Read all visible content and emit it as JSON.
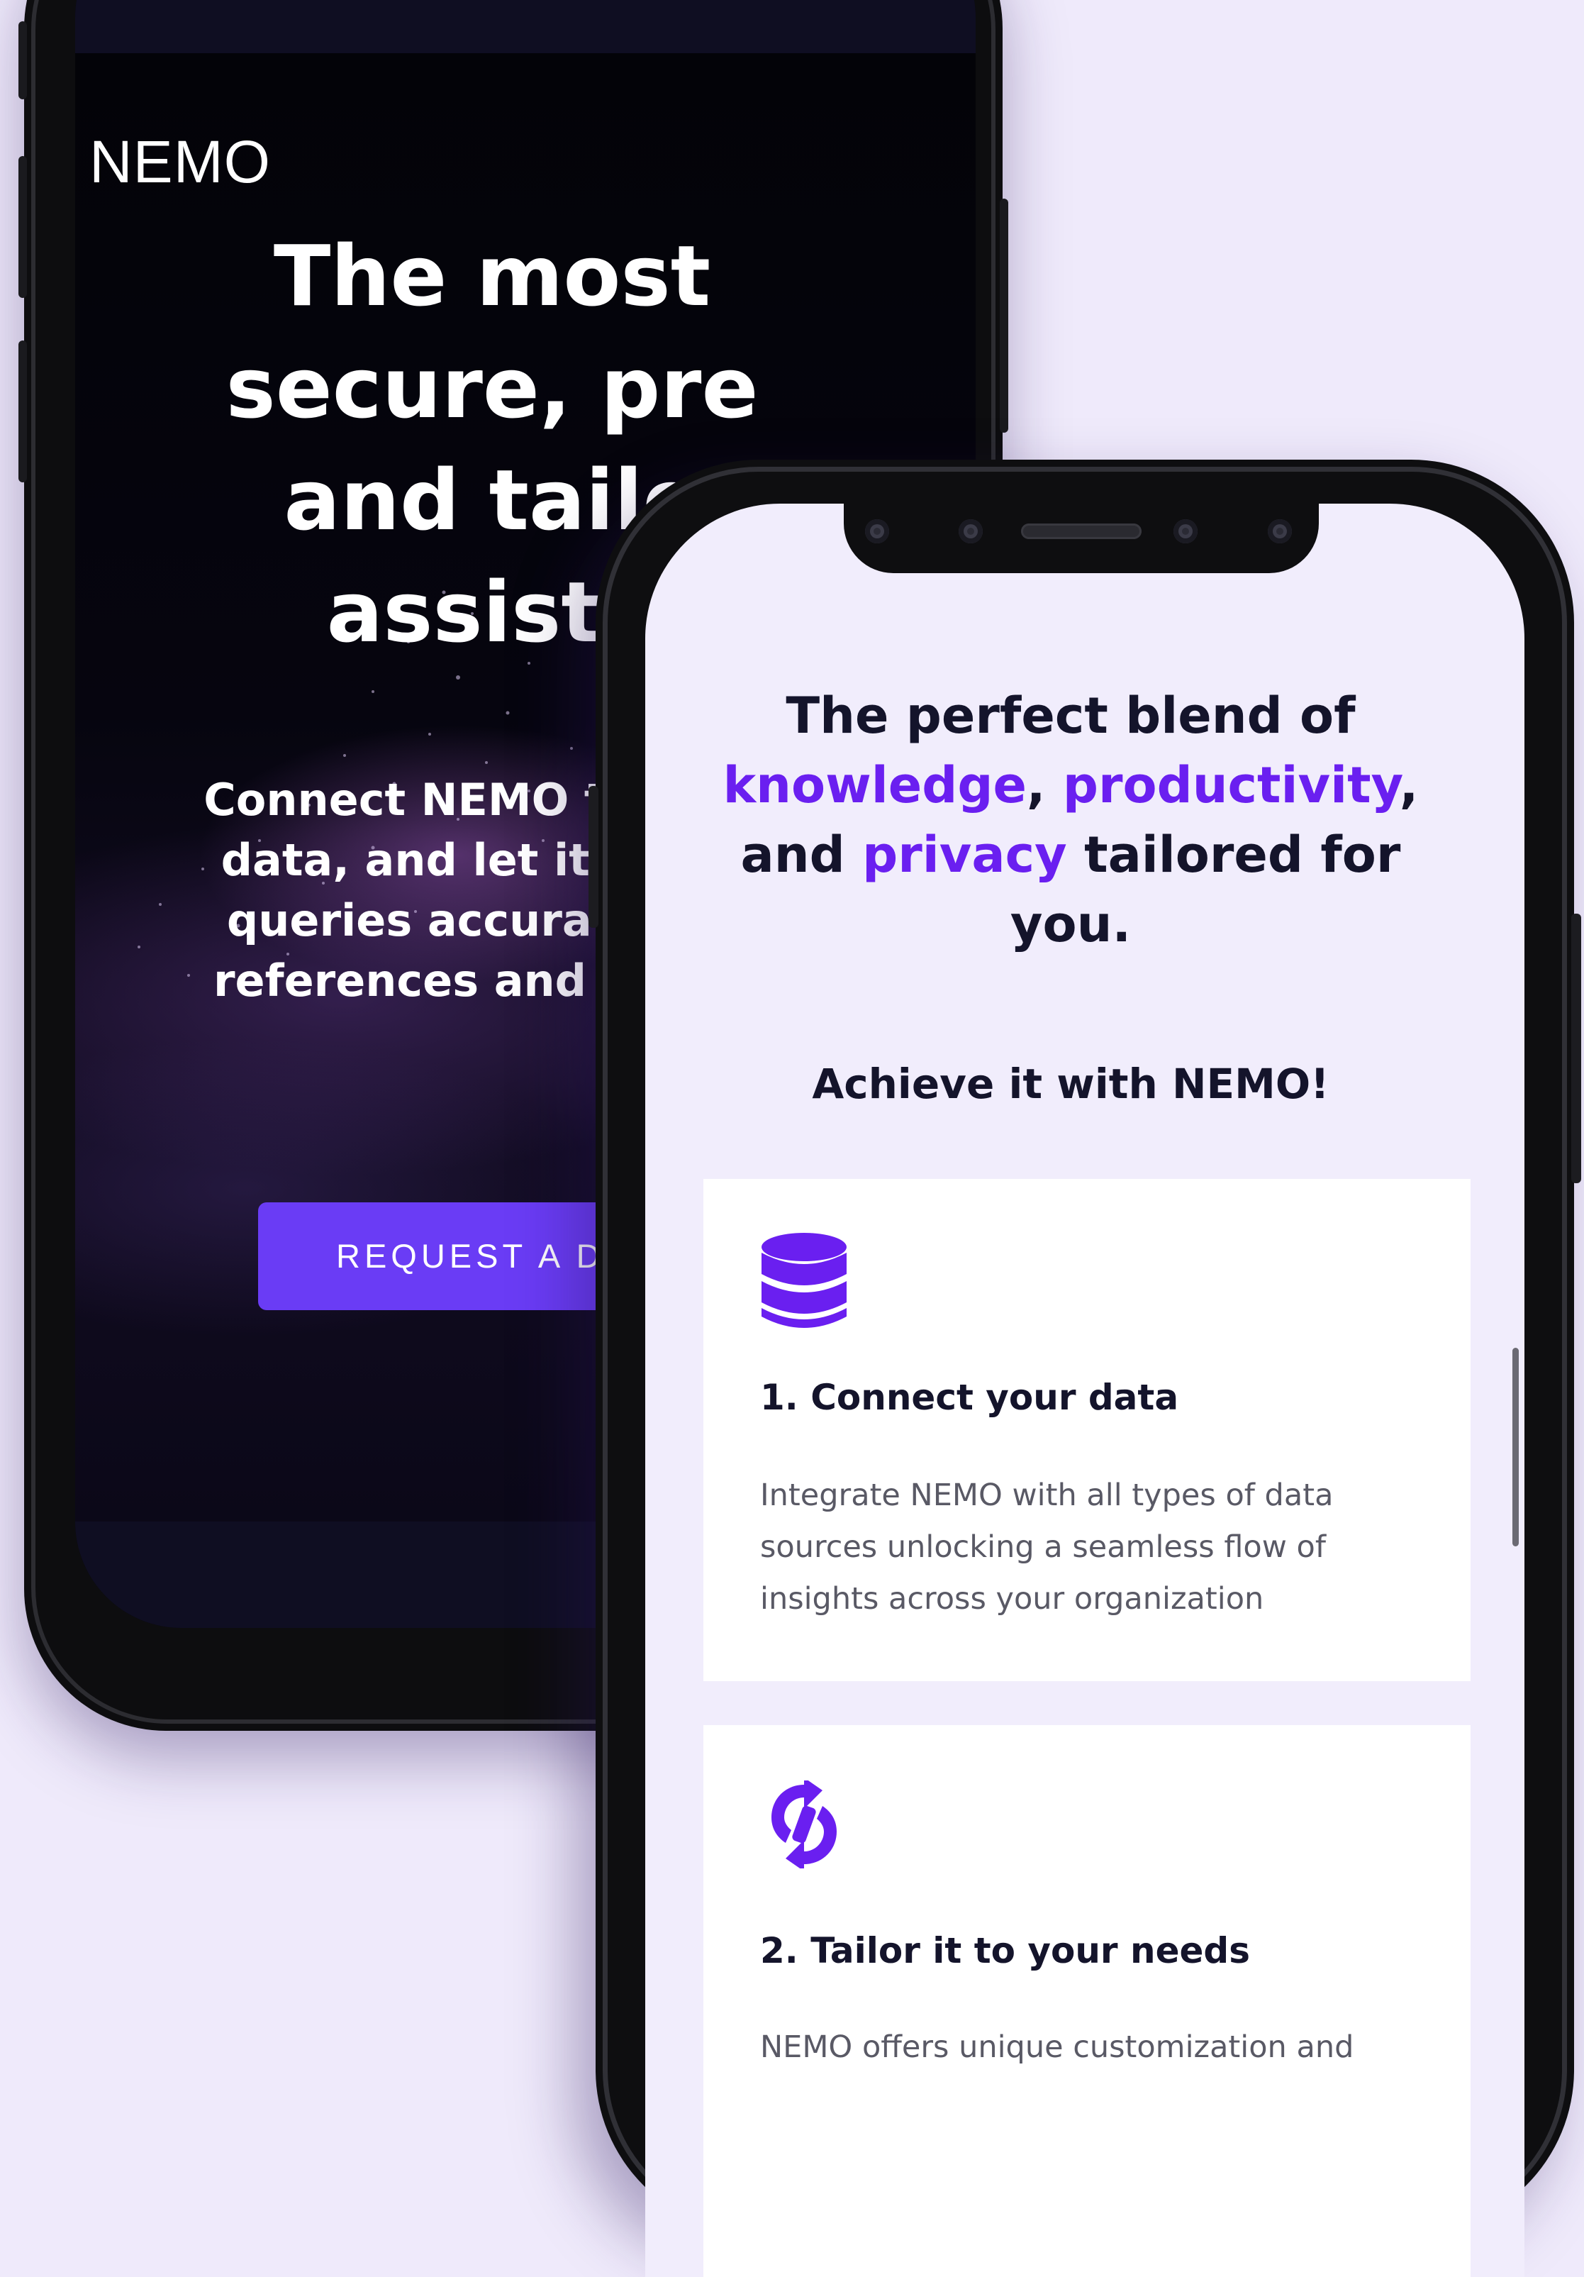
{
  "back_phone": {
    "logo": "NEMO",
    "hero_title": "The most secure, pr… and tailo… assist…",
    "hero_title_lines": [
      "The most",
      "secure, pre",
      "and tailo",
      "assista"
    ],
    "hero_subtitle_lines": [
      "Connect NEMO to yo",
      "data, and let it ans",
      "queries accurately",
      "references and utm"
    ],
    "cta_label": "REQUEST A DE"
  },
  "front_phone": {
    "section_title": {
      "line1": "The perfect blend of",
      "kw1": "knowledge",
      "sep1": ", ",
      "kw2": "productivity",
      "sep2": ",",
      "line3_start": "and ",
      "kw3": "privacy",
      "line3_end": " tailored for",
      "line4": "you."
    },
    "section_subtitle": "Achieve it with NEMO!",
    "features": [
      {
        "icon": "database-icon",
        "title": "1. Connect your data",
        "description": "Integrate NEMO with all types of data sources unlocking a seamless flow of insights across your organization"
      },
      {
        "icon": "sync-arrows-icon",
        "title": "2. Tailor it to your needs",
        "description": "NEMO offers unique customization and"
      }
    ]
  },
  "colors": {
    "page_background": "#efeafb",
    "accent": "#6a3cf5",
    "highlight_text": "#6a1ff0",
    "heading_text": "#14142b",
    "body_text": "#595965"
  }
}
